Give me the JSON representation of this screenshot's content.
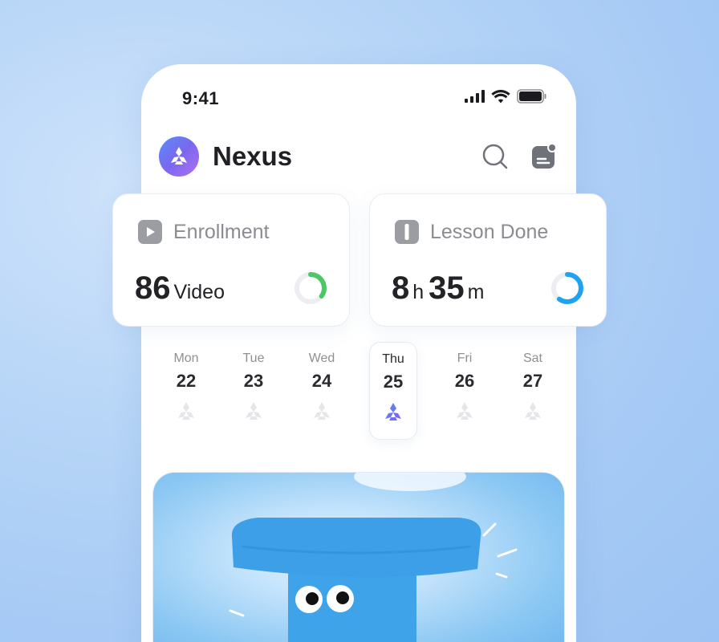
{
  "status_bar": {
    "time": "9:41"
  },
  "app": {
    "title": "Nexus"
  },
  "header": {
    "search_icon": "search-icon",
    "notes_icon": "notes-icon"
  },
  "stats": {
    "enrollment": {
      "label": "Enrollment",
      "value": "86",
      "unit": "Video",
      "progress": 0.35,
      "color": "#4cc764"
    },
    "lesson_done": {
      "label": "Lesson Done",
      "hours": "8",
      "hours_unit": "h",
      "minutes": "35",
      "minutes_unit": "m",
      "progress": 0.6,
      "color": "#1fa2f0"
    }
  },
  "week": [
    {
      "name": "Mon",
      "num": "22",
      "selected": false
    },
    {
      "name": "Tue",
      "num": "23",
      "selected": false
    },
    {
      "name": "Wed",
      "num": "24",
      "selected": false
    },
    {
      "name": "Thu",
      "num": "25",
      "selected": true
    },
    {
      "name": "Fri",
      "num": "26",
      "selected": false
    },
    {
      "name": "Sat",
      "num": "27",
      "selected": false
    }
  ],
  "colors": {
    "accent": "#6b6cf0",
    "muted_icon": "#e4e6ea"
  }
}
